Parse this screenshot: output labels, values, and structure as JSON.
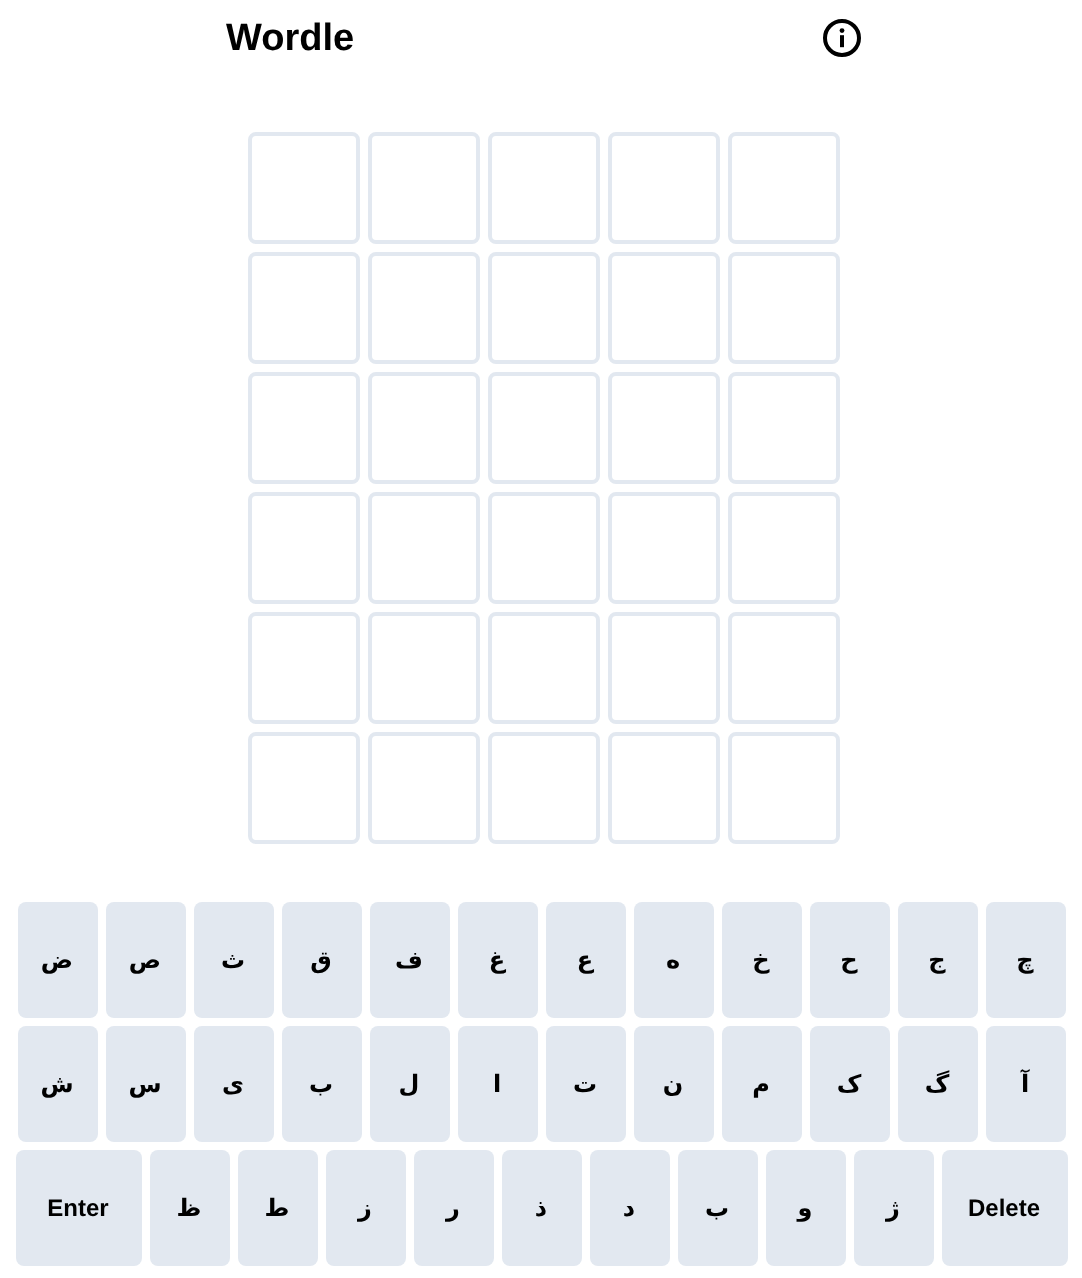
{
  "header": {
    "title": "Wordle"
  },
  "grid": [
    [
      {
        "filled": false
      },
      {
        "filled": false
      },
      {
        "filled": false
      },
      {
        "filled": false
      },
      {
        "filled": false
      }
    ],
    [
      {
        "filled": false
      },
      {
        "filled": false
      },
      {
        "filled": false
      },
      {
        "filled": false
      },
      {
        "filled": false
      }
    ],
    [
      {
        "filled": false
      },
      {
        "filled": false
      },
      {
        "filled": false
      },
      {
        "filled": false
      },
      {
        "filled": false
      }
    ],
    [
      {
        "filled": false
      },
      {
        "filled": false
      },
      {
        "filled": false
      },
      {
        "filled": false
      },
      {
        "filled": false
      }
    ],
    [
      {
        "filled": false
      },
      {
        "filled": false
      },
      {
        "filled": false
      },
      {
        "filled": false
      },
      {
        "filled": false
      }
    ],
    [
      {
        "filled": false
      },
      {
        "filled": false
      },
      {
        "filled": false
      },
      {
        "filled": false
      },
      {
        "filled": false
      }
    ]
  ],
  "keyboard": [
    [
      {
        "kind": "letter",
        "label": "چ"
      },
      {
        "kind": "letter",
        "label": "ج"
      },
      {
        "kind": "letter",
        "label": "ح"
      },
      {
        "kind": "letter",
        "label": "خ"
      },
      {
        "kind": "letter",
        "label": "ه"
      },
      {
        "kind": "letter",
        "label": "ع"
      },
      {
        "kind": "letter",
        "label": "غ"
      },
      {
        "kind": "letter",
        "label": "ف"
      },
      {
        "kind": "letter",
        "label": "ق"
      },
      {
        "kind": "letter",
        "label": "ث"
      },
      {
        "kind": "letter",
        "label": "ص"
      },
      {
        "kind": "letter",
        "label": "ض"
      }
    ],
    [
      {
        "kind": "letter",
        "label": "آ"
      },
      {
        "kind": "letter",
        "label": "گ"
      },
      {
        "kind": "letter",
        "label": "ک"
      },
      {
        "kind": "letter",
        "label": "م"
      },
      {
        "kind": "letter",
        "label": "ن"
      },
      {
        "kind": "letter",
        "label": "ت"
      },
      {
        "kind": "letter",
        "label": "ا"
      },
      {
        "kind": "letter",
        "label": "ل"
      },
      {
        "kind": "letter",
        "label": "ب"
      },
      {
        "kind": "letter",
        "label": "ی"
      },
      {
        "kind": "letter",
        "label": "س"
      },
      {
        "kind": "letter",
        "label": "ش"
      }
    ],
    [
      {
        "kind": "action",
        "label": "Delete"
      },
      {
        "kind": "letter",
        "label": "ژ"
      },
      {
        "kind": "letter",
        "label": "و"
      },
      {
        "kind": "letter",
        "label": "ب"
      },
      {
        "kind": "letter",
        "label": "د"
      },
      {
        "kind": "letter",
        "label": "ذ"
      },
      {
        "kind": "letter",
        "label": "ر"
      },
      {
        "kind": "letter",
        "label": "ز"
      },
      {
        "kind": "letter",
        "label": "ط"
      },
      {
        "kind": "letter",
        "label": "ظ"
      },
      {
        "kind": "action",
        "label": "Enter"
      }
    ]
  ]
}
